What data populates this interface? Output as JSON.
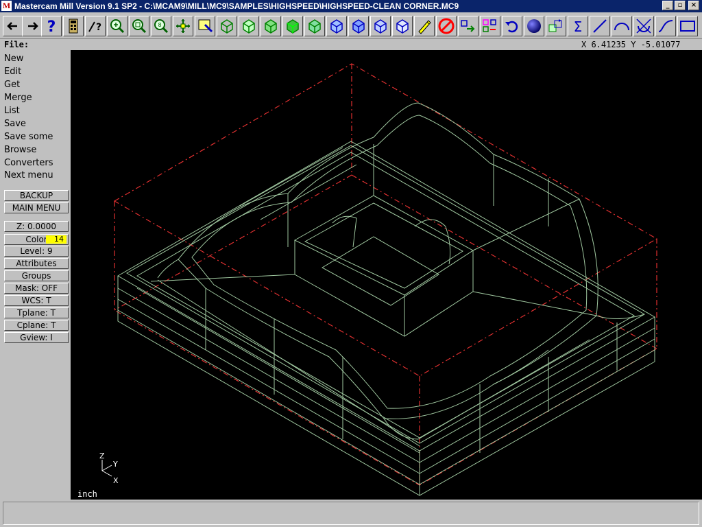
{
  "window": {
    "title": "Mastercam Mill Version 9.1 SP2 - C:\\MCAM9\\MILL\\MC9\\SAMPLES\\HIGHSPEED\\HIGHSPEED-CLEAN CORNER.MC9",
    "app_icon_text": "M",
    "min_label": "_",
    "max_label": "▫",
    "close_label": "×"
  },
  "toolbar": {
    "buttons": [
      "back-arrow",
      "forward-arrow",
      "help",
      "calculator",
      "analyze",
      "zoom-window",
      "zoom-fit",
      "zoom-percent",
      "pan",
      "screen-select",
      "view-cube",
      "view-top",
      "view-front",
      "view-side",
      "view-iso",
      "view-cube-blue-1",
      "view-cube-blue-2",
      "view-cube-blue-3",
      "view-cube-blue-4",
      "eraser",
      "delete-no",
      "translate",
      "copy-multi",
      "undo",
      "sphere-shade",
      "grid-xform",
      "sigma",
      "line",
      "arc",
      "fillet",
      "spline",
      "rectangle"
    ]
  },
  "status": {
    "file_label": "File:",
    "coords": "X 6.41235  Y -5.01077"
  },
  "menu": {
    "items": [
      "New",
      "Edit",
      "Get",
      "Merge",
      "List",
      "Save",
      "Save some",
      "Browse",
      "Converters",
      "Next menu"
    ],
    "backup": "BACKUP",
    "main_menu": "MAIN MENU"
  },
  "panel": {
    "z": "Z:  0.0000",
    "color_label": "Color:",
    "color_value": "14",
    "level": "Level:  9",
    "attributes": "Attributes",
    "groups": "Groups",
    "mask": "Mask:  OFF",
    "wcs": "WCS:   T",
    "tplane": "Tplane:  T",
    "cplane": "Cplane:  T",
    "gview": "Gview:   I"
  },
  "viewport": {
    "units": "inch",
    "axis_z": "Z",
    "axis_y": "Y",
    "axis_x": "X",
    "colors": {
      "background": "#000000",
      "geometry": "#a0c8a0",
      "boundary": "#e03030"
    }
  },
  "prompt": {
    "text": ""
  }
}
